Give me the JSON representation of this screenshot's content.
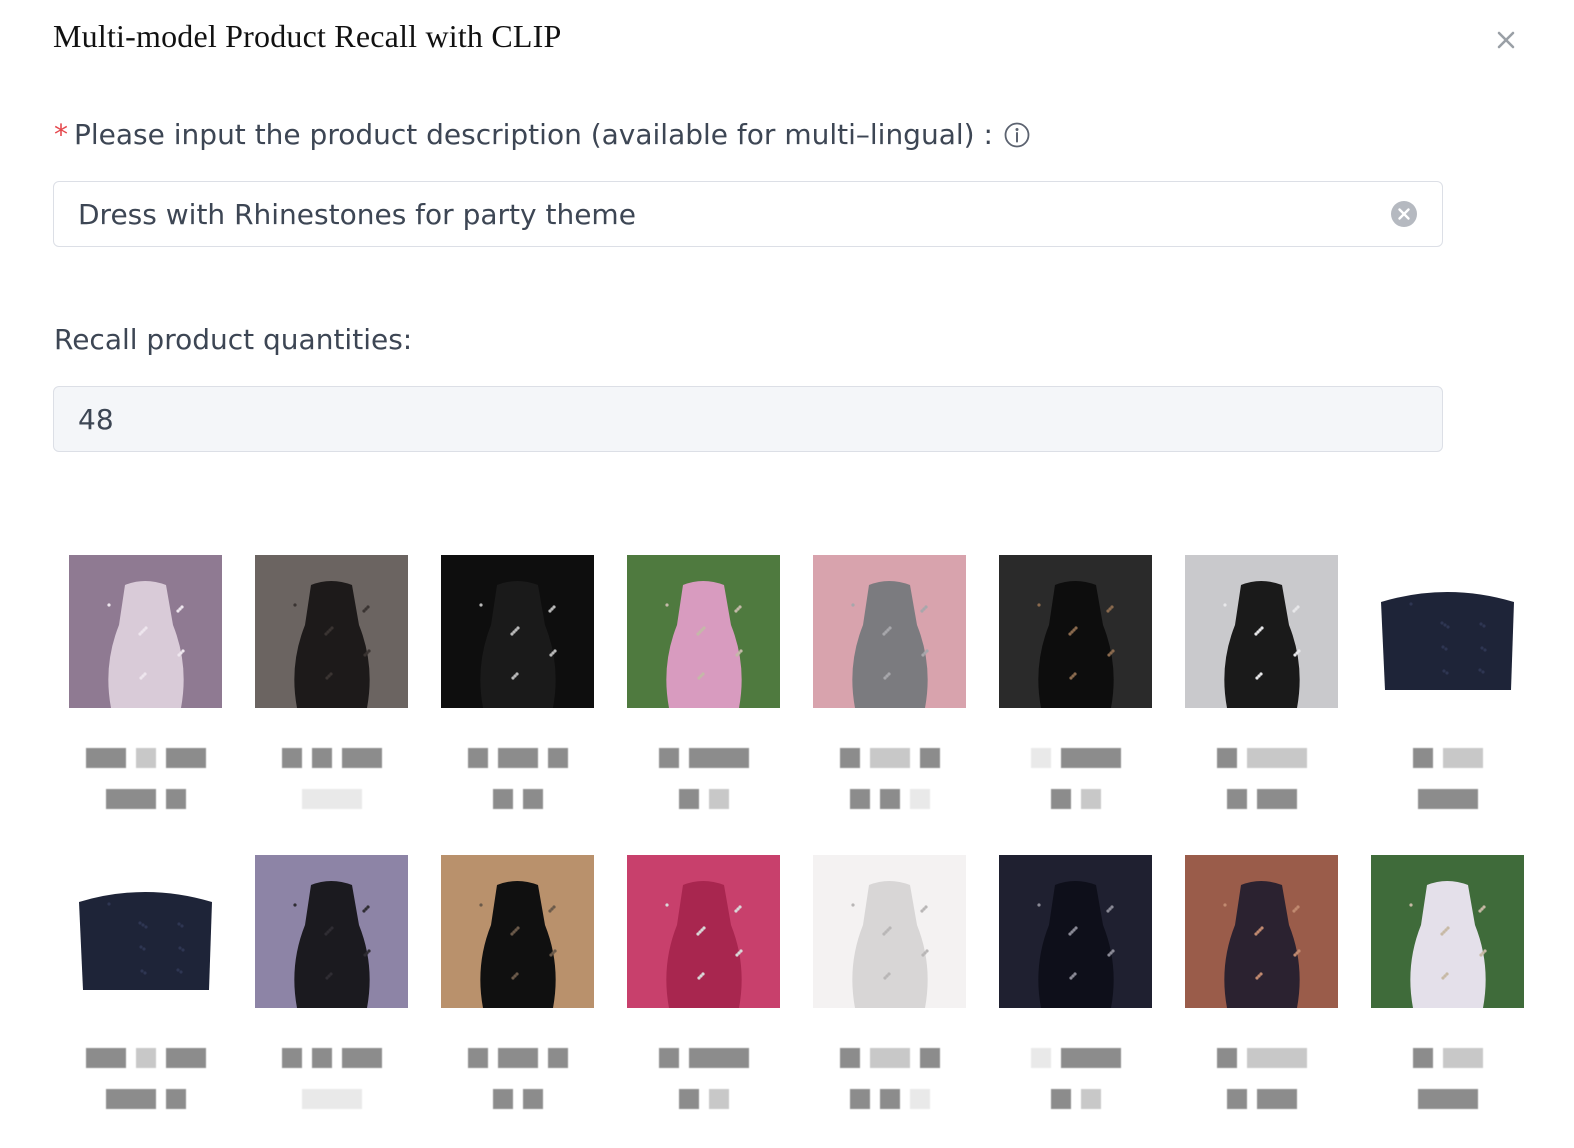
{
  "dialog": {
    "title": "Multi-model Product Recall with CLIP",
    "close_icon": "close-icon"
  },
  "description": {
    "required_mark": "*",
    "label": "Please input the product description (available for multi–lingual) :",
    "value": "Dress with Rhinestones for party theme",
    "info_icon": "info-circle-icon",
    "clear_icon": "clear-circle-icon"
  },
  "quantity": {
    "label": "Recall product quantities:",
    "value": "48"
  },
  "results": {
    "products": [
      {
        "desc": "sparkly silver rhinestone halter dress on purple backdrop",
        "colors": [
          "#8f7a92",
          "#d9cbd8",
          "#eee6ee"
        ]
      },
      {
        "desc": "black sheer rhinestone mini dress",
        "colors": [
          "#6b6461",
          "#1d1a1a",
          "#3a3432"
        ]
      },
      {
        "desc": "black dress with rhinestone waist chain",
        "colors": [
          "#0e0e0e",
          "#1a1a1a",
          "#b9b9b9"
        ]
      },
      {
        "desc": "pink sequin one-shoulder dress outdoors",
        "colors": [
          "#4f7a3f",
          "#d89bbf",
          "#c4b9a8"
        ]
      },
      {
        "desc": "grey sequin halter dress on pink backdrop",
        "colors": [
          "#d8a3ad",
          "#7b7b7f",
          "#a7a7ab"
        ]
      },
      {
        "desc": "black fringe sequin dress by staircase",
        "colors": [
          "#2a2a2a",
          "#0d0d0d",
          "#8a6a4e"
        ]
      },
      {
        "desc": "black fringe mini dress on grey backdrop",
        "colors": [
          "#c9c9cc",
          "#1a1a1a",
          "#e8e8ea"
        ]
      },
      {
        "desc": "navy strapless rhinestone bodice",
        "colors": [
          "#ffffff",
          "#1e2438",
          "#2e3652"
        ]
      },
      {
        "desc": "navy strapless rhinestone bodice",
        "colors": [
          "#ffffff",
          "#1e2438",
          "#2e3652"
        ]
      },
      {
        "desc": "black sparkly cowl dress on lavender backdrop",
        "colors": [
          "#8d84a6",
          "#1b1a1f",
          "#2f2d33"
        ]
      },
      {
        "desc": "black backless rhinestone long-sleeve dress",
        "colors": [
          "#b9916c",
          "#101010",
          "#6b5a4a"
        ]
      },
      {
        "desc": "pink satin dress with rhinestone fringe belt",
        "colors": [
          "#c8406c",
          "#a8264f",
          "#d8d8d8"
        ]
      },
      {
        "desc": "white sequin halter mini dress",
        "colors": [
          "#f4f2f2",
          "#d8d6d6",
          "#b8b6b6"
        ]
      },
      {
        "desc": "black rhinestone diamond-pattern skirt",
        "colors": [
          "#1f2030",
          "#0e0f1a",
          "#8a8a96"
        ]
      },
      {
        "desc": "dark sequin mini dress on rock backdrop",
        "colors": [
          "#9a5c4a",
          "#2b2230",
          "#c18a70"
        ]
      },
      {
        "desc": "white sequin slip dress outdoors",
        "colors": [
          "#3f6b3a",
          "#e4e0ea",
          "#c7b9a5"
        ]
      }
    ]
  }
}
